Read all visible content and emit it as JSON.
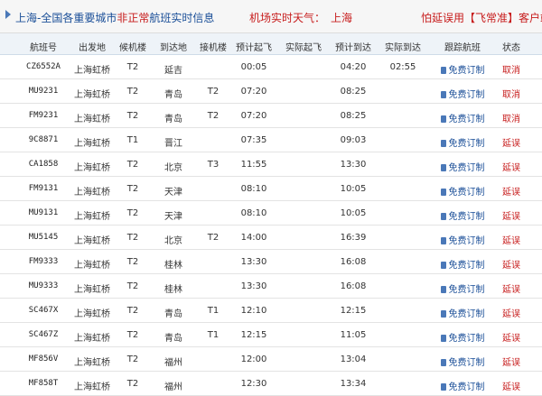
{
  "header": {
    "title_prefix": "上海",
    "title_middle": "-全国各重要城市",
    "title_red": "非正常",
    "title_suffix": "航班实时信息",
    "weather_label": "机场实时天气：",
    "weather_city": "上海",
    "ad_text": "怕延误用【飞常准】客户端"
  },
  "table": {
    "columns": [
      "航班号",
      "出发地",
      "候机楼",
      "到达地",
      "接机楼",
      "预计起飞",
      "实际起飞",
      "预计到达",
      "实际到达",
      "跟踪航班",
      "状态"
    ],
    "rows": [
      {
        "flight": "CZ6552A",
        "from": "上海虹桥",
        "dep_term": "T2",
        "to": "延吉",
        "arr_term": "",
        "sched_dep": "00:05",
        "actual_dep": "",
        "sched_arr": "04:20",
        "actual_arr": "02:55",
        "track": "免费订制",
        "status": "取消"
      },
      {
        "flight": "MU9231",
        "from": "上海虹桥",
        "dep_term": "T2",
        "to": "青岛",
        "arr_term": "T2",
        "sched_dep": "07:20",
        "actual_dep": "",
        "sched_arr": "08:25",
        "actual_arr": "",
        "track": "免费订制",
        "status": "取消"
      },
      {
        "flight": "FM9231",
        "from": "上海虹桥",
        "dep_term": "T2",
        "to": "青岛",
        "arr_term": "T2",
        "sched_dep": "07:20",
        "actual_dep": "",
        "sched_arr": "08:25",
        "actual_arr": "",
        "track": "免费订制",
        "status": "取消"
      },
      {
        "flight": "9C8871",
        "from": "上海虹桥",
        "dep_term": "T1",
        "to": "晋江",
        "arr_term": "",
        "sched_dep": "07:35",
        "actual_dep": "",
        "sched_arr": "09:03",
        "actual_arr": "",
        "track": "免费订制",
        "status": "延误"
      },
      {
        "flight": "CA1858",
        "from": "上海虹桥",
        "dep_term": "T2",
        "to": "北京",
        "arr_term": "T3",
        "sched_dep": "11:55",
        "actual_dep": "",
        "sched_arr": "13:30",
        "actual_arr": "",
        "track": "免费订制",
        "status": "延误"
      },
      {
        "flight": "FM9131",
        "from": "上海虹桥",
        "dep_term": "T2",
        "to": "天津",
        "arr_term": "",
        "sched_dep": "08:10",
        "actual_dep": "",
        "sched_arr": "10:05",
        "actual_arr": "",
        "track": "免费订制",
        "status": "延误"
      },
      {
        "flight": "MU9131",
        "from": "上海虹桥",
        "dep_term": "T2",
        "to": "天津",
        "arr_term": "",
        "sched_dep": "08:10",
        "actual_dep": "",
        "sched_arr": "10:05",
        "actual_arr": "",
        "track": "免费订制",
        "status": "延误"
      },
      {
        "flight": "MU5145",
        "from": "上海虹桥",
        "dep_term": "T2",
        "to": "北京",
        "arr_term": "T2",
        "sched_dep": "14:00",
        "actual_dep": "",
        "sched_arr": "16:39",
        "actual_arr": "",
        "track": "免费订制",
        "status": "延误"
      },
      {
        "flight": "FM9333",
        "from": "上海虹桥",
        "dep_term": "T2",
        "to": "桂林",
        "arr_term": "",
        "sched_dep": "13:30",
        "actual_dep": "",
        "sched_arr": "16:08",
        "actual_arr": "",
        "track": "免费订制",
        "status": "延误"
      },
      {
        "flight": "MU9333",
        "from": "上海虹桥",
        "dep_term": "T2",
        "to": "桂林",
        "arr_term": "",
        "sched_dep": "13:30",
        "actual_dep": "",
        "sched_arr": "16:08",
        "actual_arr": "",
        "track": "免费订制",
        "status": "延误"
      },
      {
        "flight": "SC467X",
        "from": "上海虹桥",
        "dep_term": "T2",
        "to": "青岛",
        "arr_term": "T1",
        "sched_dep": "12:10",
        "actual_dep": "",
        "sched_arr": "12:15",
        "actual_arr": "",
        "track": "免费订制",
        "status": "延误"
      },
      {
        "flight": "SC467Z",
        "from": "上海虹桥",
        "dep_term": "T2",
        "to": "青岛",
        "arr_term": "T1",
        "sched_dep": "12:15",
        "actual_dep": "",
        "sched_arr": "11:05",
        "actual_arr": "",
        "track": "免费订制",
        "status": "延误"
      },
      {
        "flight": "MF856V",
        "from": "上海虹桥",
        "dep_term": "T2",
        "to": "福州",
        "arr_term": "",
        "sched_dep": "12:00",
        "actual_dep": "",
        "sched_arr": "13:04",
        "actual_arr": "",
        "track": "免费订制",
        "status": "延误"
      },
      {
        "flight": "MF858T",
        "from": "上海虹桥",
        "dep_term": "T2",
        "to": "福州",
        "arr_term": "",
        "sched_dep": "12:30",
        "actual_dep": "",
        "sched_arr": "13:34",
        "actual_arr": "",
        "track": "免费订制",
        "status": "延误"
      }
    ]
  },
  "colors": {
    "accent_blue": "#1b4f98",
    "status_red": "#c71c1c",
    "header_bg": "#eef3f8"
  },
  "icons": {
    "title_arrow": "play-arrow-icon",
    "subscribe": "phone-icon"
  }
}
